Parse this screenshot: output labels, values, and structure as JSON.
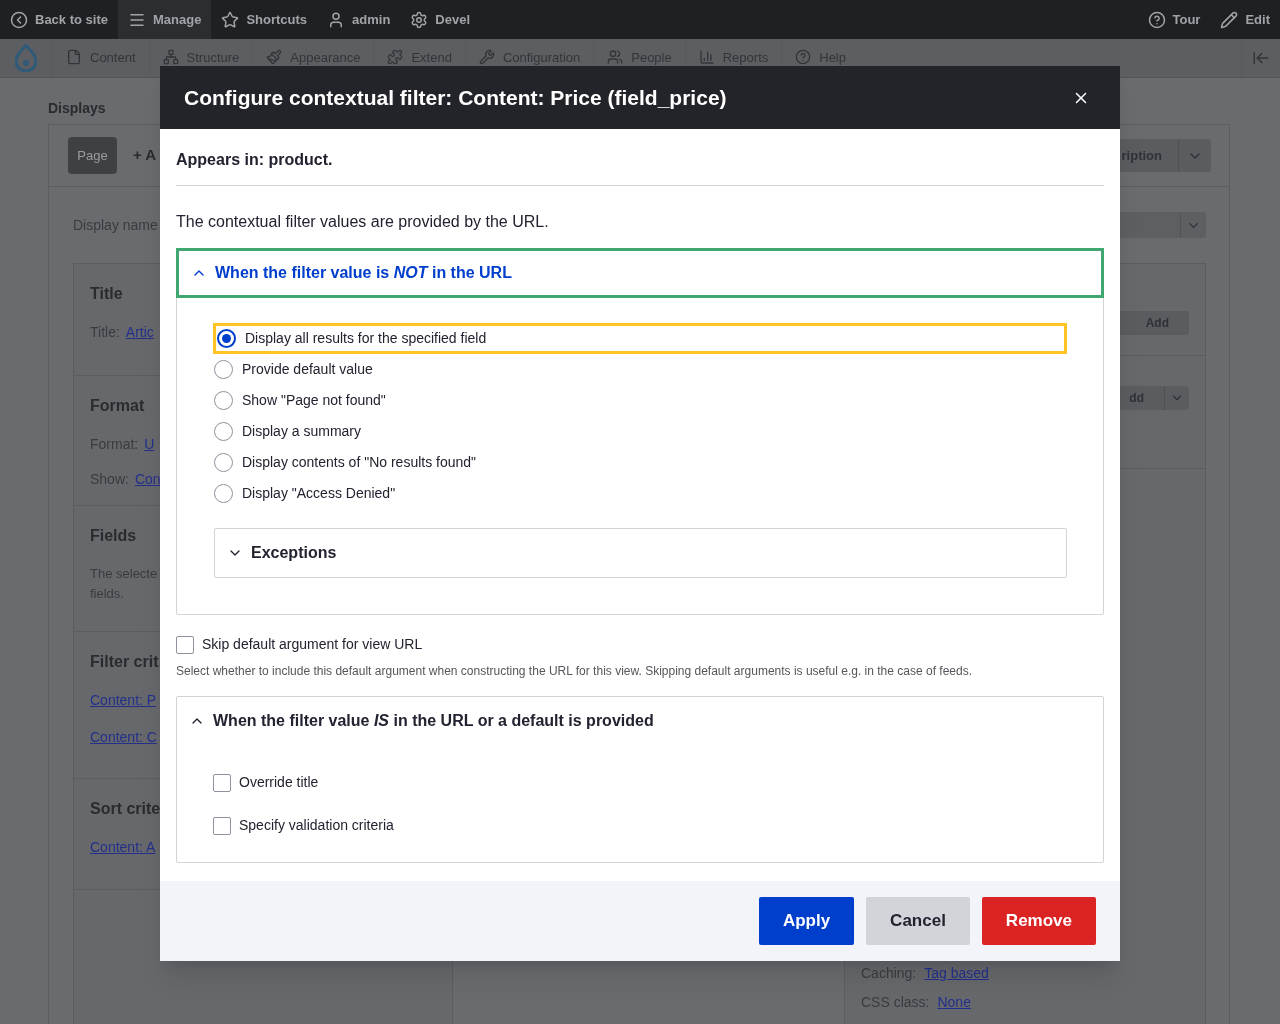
{
  "toolbar": {
    "items": [
      {
        "label": "Back to site",
        "selected": false
      },
      {
        "label": "Manage",
        "selected": true
      },
      {
        "label": "Shortcuts",
        "selected": false
      },
      {
        "label": "admin",
        "selected": false
      },
      {
        "label": "Devel",
        "selected": false
      }
    ],
    "right": [
      "Tour",
      "Edit"
    ]
  },
  "admin_menu": [
    "Content",
    "Structure",
    "Appearance",
    "Extend",
    "Configuration",
    "People",
    "Reports",
    "Help"
  ],
  "page": {
    "heading": "Displays",
    "display_tab": "Page",
    "add_tab": "+ A",
    "top_button": "ription",
    "display_name_label": "Display name",
    "left_sections": [
      {
        "title": "Title",
        "lines": [
          {
            "label": "Title:",
            "link": "Artic"
          }
        ]
      },
      {
        "title": "Format",
        "lines": [
          {
            "label": "Format:",
            "link": "U"
          },
          {
            "label": "Show:",
            "link": "Con"
          }
        ]
      },
      {
        "title": "Fields",
        "text": "The selecte fields."
      },
      {
        "title": "Filter crit",
        "links": [
          "Content: P",
          "Content: C"
        ]
      },
      {
        "title": "Sort crite",
        "links": [
          "Content: A"
        ]
      }
    ],
    "right_buttons": [
      {
        "label": "Add",
        "kind": "plain"
      },
      {
        "label": "dd",
        "kind": "split"
      }
    ],
    "right_lines": [
      {
        "label": "Caching:",
        "link": "Tag based"
      },
      {
        "label": "CSS class:",
        "link": "None"
      }
    ]
  },
  "modal": {
    "title": "Configure contextual filter: Content: Price (field_price)",
    "appears_in": "Appears in: product.",
    "intro": "The contextual filter values are provided by the URL.",
    "not_in_url": {
      "summary": "When the filter value is *NOT* in the URL",
      "expanded": true,
      "focused": true,
      "options": [
        {
          "label": "Display all results for the specified field",
          "selected": true,
          "focused": true
        },
        {
          "label": "Provide default value",
          "selected": false,
          "focused": false
        },
        {
          "label": "Show \"Page not found\"",
          "selected": false,
          "focused": false
        },
        {
          "label": "Display a summary",
          "selected": false,
          "focused": false
        },
        {
          "label": "Display contents of \"No results found\"",
          "selected": false,
          "focused": false
        },
        {
          "label": "Display \"Access Denied\"",
          "selected": false,
          "focused": false
        }
      ],
      "exceptions": {
        "summary": "Exceptions",
        "expanded": false
      }
    },
    "skip": {
      "label": "Skip default argument for view URL",
      "checked": false,
      "description": "Select whether to include this default argument when constructing the URL for this view. Skipping default arguments is useful e.g. in the case of feeds."
    },
    "in_url": {
      "summary": "When the filter value *IS* in the URL or a default is provided",
      "expanded": true,
      "focused": false,
      "options": [
        {
          "label": "Override title",
          "checked": false
        },
        {
          "label": "Specify validation criteria",
          "checked": false
        }
      ]
    },
    "buttons": [
      {
        "label": "Apply",
        "kind": "primary"
      },
      {
        "label": "Cancel",
        "kind": "secondary"
      },
      {
        "label": "Remove",
        "kind": "danger"
      }
    ]
  }
}
